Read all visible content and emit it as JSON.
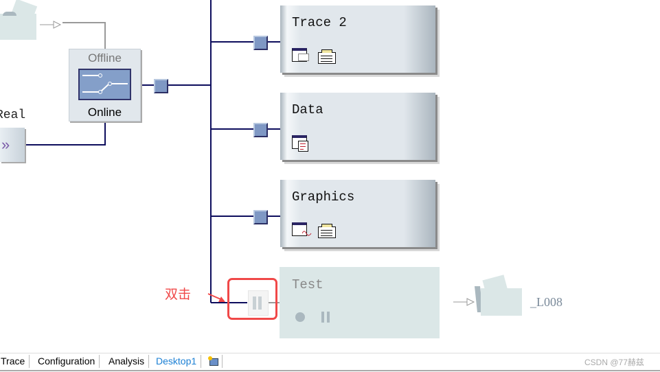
{
  "switch": {
    "top_label": "Offline",
    "bottom_label": "Online"
  },
  "left": {
    "real_label": "Real",
    "button_glyph": "»"
  },
  "blocks": [
    {
      "title": "Trace 2",
      "icons": [
        "trace-window-icon",
        "notes-icon"
      ]
    },
    {
      "title": "Data",
      "icons": [
        "data-window-icon"
      ]
    },
    {
      "title": "Graphics",
      "icons": [
        "graphics-window-icon",
        "notes-icon"
      ]
    },
    {
      "title": "Test",
      "state": "disabled",
      "icons": [
        "record-icon",
        "pause-icon"
      ]
    }
  ],
  "annotation": {
    "text": "双击",
    "color": "#f04848"
  },
  "logging": {
    "label": "_L008"
  },
  "tabs": [
    {
      "label": "Trace"
    },
    {
      "label": "Configuration"
    },
    {
      "label": "Analysis"
    },
    {
      "label": "Desktop1",
      "active": true
    }
  ],
  "watermark": "CSDN @77赫兹",
  "colors": {
    "line": "#0c0c5c",
    "block": "#e1e7ec",
    "disabled": "#dbe7e7",
    "accent": "#1a7fd4"
  }
}
